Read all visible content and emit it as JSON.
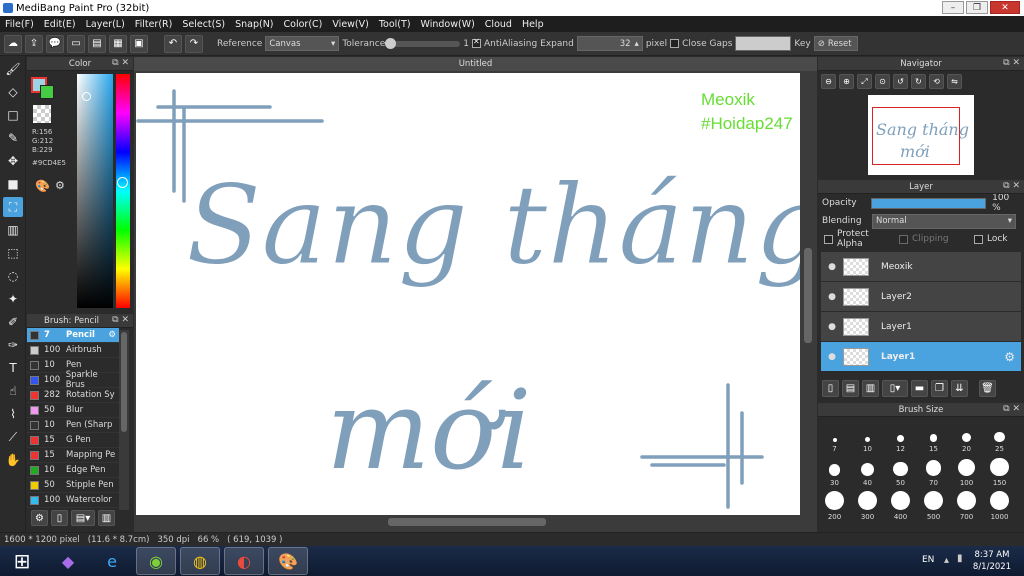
{
  "window": {
    "title": "MediBang Paint Pro (32bit)"
  },
  "menu": [
    "File(F)",
    "Edit(E)",
    "Layer(L)",
    "Filter(R)",
    "Select(S)",
    "Snap(N)",
    "Color(C)",
    "View(V)",
    "Tool(T)",
    "Window(W)",
    "Cloud",
    "Help"
  ],
  "toolbar": {
    "reference_label": "Reference",
    "reference_value": "Canvas",
    "tolerance_label": "Tolerance",
    "tolerance_value": "1",
    "antialiasing_label": "AntiAliasing",
    "expand_label": "Expand",
    "expand_value": "32",
    "expand_unit": "pixel",
    "closegaps_label": "Close Gaps",
    "key_label": "Key",
    "reset_label": "Reset"
  },
  "color_panel": {
    "title": "Color",
    "r": "R:156",
    "g": "G:212",
    "b": "B:229",
    "hex": "#9CD4E5",
    "fg_color": "#9CD4E5",
    "bg_color": "#ffffff"
  },
  "brush_panel": {
    "title": "Brush: Pencil",
    "items": [
      {
        "size": "7",
        "name": "Pencil",
        "color": "#333333"
      },
      {
        "size": "100",
        "name": "Airbrush",
        "color": "#cccccc"
      },
      {
        "size": "10",
        "name": "Pen",
        "color": "#333333"
      },
      {
        "size": "100",
        "name": "Sparkle Brus",
        "color": "#3355ee"
      },
      {
        "size": "282",
        "name": "Rotation Sy",
        "color": "#ee3333"
      },
      {
        "size": "50",
        "name": "Blur",
        "color": "#ee99ee"
      },
      {
        "size": "10",
        "name": "Pen (Sharp",
        "color": "#333333"
      },
      {
        "size": "15",
        "name": "G Pen",
        "color": "#ee3333"
      },
      {
        "size": "15",
        "name": "Mapping Pe",
        "color": "#ee3333"
      },
      {
        "size": "10",
        "name": "Edge Pen",
        "color": "#22aa22"
      },
      {
        "size": "50",
        "name": "Stipple Pen",
        "color": "#eecc00"
      },
      {
        "size": "100",
        "name": "Watercolor",
        "color": "#33bbee"
      }
    ]
  },
  "canvas": {
    "tab_title": "Untitled",
    "watermark_1": "Meoxik",
    "watermark_2": "#Hoidap247",
    "art_line1": "Sang tháng",
    "art_line2": "mới",
    "art_color": "#7f9fbb",
    "watermark_color": "#66dd33"
  },
  "navigator": {
    "title": "Navigator"
  },
  "layer_panel": {
    "title": "Layer",
    "opacity_label": "Opacity",
    "opacity_value": "100 %",
    "opacity_fraction": 1.0,
    "blending_label": "Blending",
    "blending_value": "Normal",
    "protect_alpha": "Protect Alpha",
    "clipping": "Clipping",
    "lock": "Lock",
    "layers": [
      {
        "name": "Meoxik",
        "active": false
      },
      {
        "name": "Layer2",
        "active": false
      },
      {
        "name": "Layer1",
        "active": false
      },
      {
        "name": "Layer1",
        "active": true
      }
    ]
  },
  "brush_size_panel": {
    "title": "Brush Size",
    "sizes": [
      "7",
      "10",
      "12",
      "15",
      "20",
      "25",
      "30",
      "40",
      "50",
      "70",
      "100",
      "150",
      "200",
      "300",
      "400",
      "500",
      "700",
      "1000"
    ]
  },
  "status": {
    "dims": "1600 * 1200 pixel",
    "physical": "(11.6 * 8.7cm)",
    "dpi": "350 dpi",
    "zoom": "66 %",
    "coords": "( 619, 1039 )"
  },
  "taskbar": {
    "lang": "EN",
    "time": "8:37 AM",
    "date": "8/1/2021"
  }
}
